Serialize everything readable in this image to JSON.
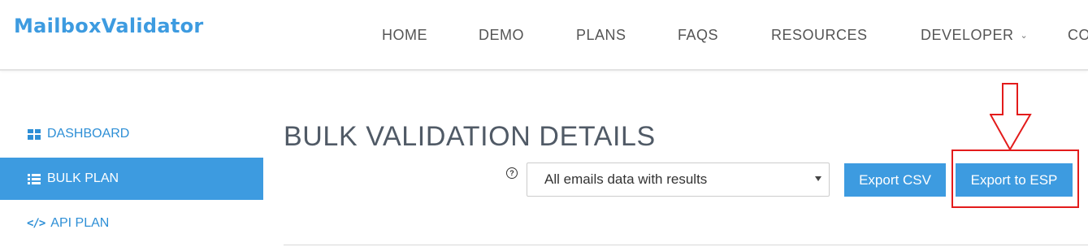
{
  "brand": {
    "logo_text": "MailboxValidator",
    "accent_color": "#3d9be0"
  },
  "nav": {
    "items": [
      {
        "label": "HOME"
      },
      {
        "label": "DEMO"
      },
      {
        "label": "PLANS"
      },
      {
        "label": "FAQS"
      },
      {
        "label": "RESOURCES"
      },
      {
        "label": "DEVELOPER",
        "has_dropdown": true
      },
      {
        "label": "CO"
      }
    ]
  },
  "sidebar": {
    "items": [
      {
        "label": "DASHBOARD",
        "icon": "dashboard-grid-icon",
        "active": false
      },
      {
        "label": "BULK PLAN",
        "icon": "list-icon",
        "active": true
      },
      {
        "label": "API PLAN",
        "icon": "code-icon",
        "icon_text": "</>",
        "active": false
      }
    ]
  },
  "main": {
    "title": "BULK VALIDATION DETAILS",
    "help_icon_glyph": "?",
    "export_select": {
      "selected": "All emails data with results"
    },
    "buttons": {
      "export_csv": "Export CSV",
      "export_esp": "Export to ESP"
    }
  },
  "annotation": {
    "color": "#e31b1b",
    "target": "Export to ESP"
  }
}
